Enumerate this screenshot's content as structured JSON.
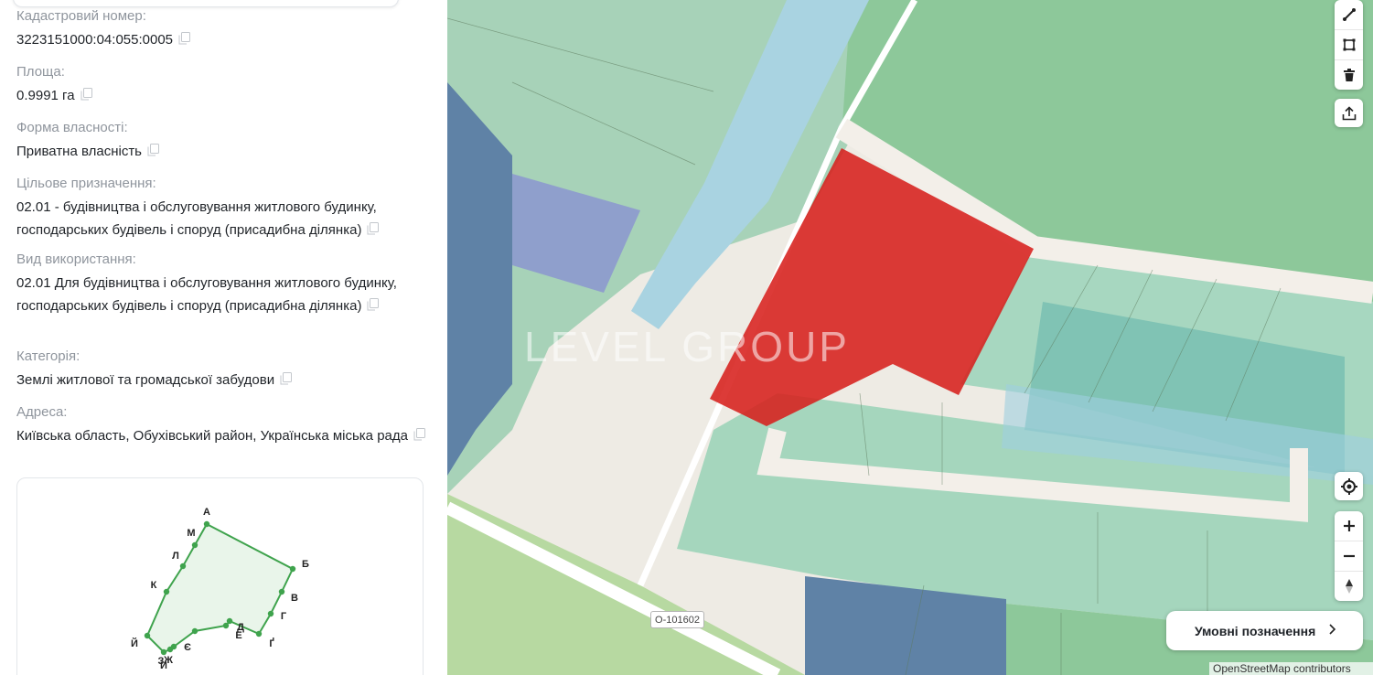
{
  "fields": [
    {
      "label": "Кадастровий номер:",
      "value": "3223151000:04:055:0005"
    },
    {
      "label": "Площа:",
      "value": "0.9991 га"
    },
    {
      "label": "Форма власності:",
      "value": "Приватна власність"
    },
    {
      "label": "Цільове призначення:",
      "value": "02.01 - будівництва і обслуговування житлового будинку, господарських будівель і споруд (присадибна ділянка)"
    },
    {
      "label": "Вид використання:",
      "value": "02.01 Для будівництва і обслуговування житлового будинку, господарських будівель і споруд (присадибна ділянка)"
    },
    {
      "label": "Категорія:",
      "value": "Землі житлової та громадської забудови"
    },
    {
      "label": "Адреса:",
      "value": "Київська область, Обухівський район, Українська міська рада"
    }
  ],
  "scheme": {
    "vertices": [
      "А",
      "Б",
      "В",
      "Г",
      "Ґ",
      "Д",
      "Е",
      "Є",
      "Ж",
      "З",
      "И",
      "Й",
      "К",
      "Л",
      "М"
    ]
  },
  "map": {
    "road_label": "О-101602",
    "watermark": "LEVEL GROUP",
    "legend_button": "Умовні позначення",
    "attribution": "OpenStreetMap contributors",
    "parcel_color": "#d7201c"
  },
  "controls": [
    "draw-line-icon",
    "draw-polygon-icon",
    "trash-icon",
    "upload-icon",
    "locate-icon",
    "zoom-in-icon",
    "zoom-out-icon",
    "compass-icon"
  ]
}
